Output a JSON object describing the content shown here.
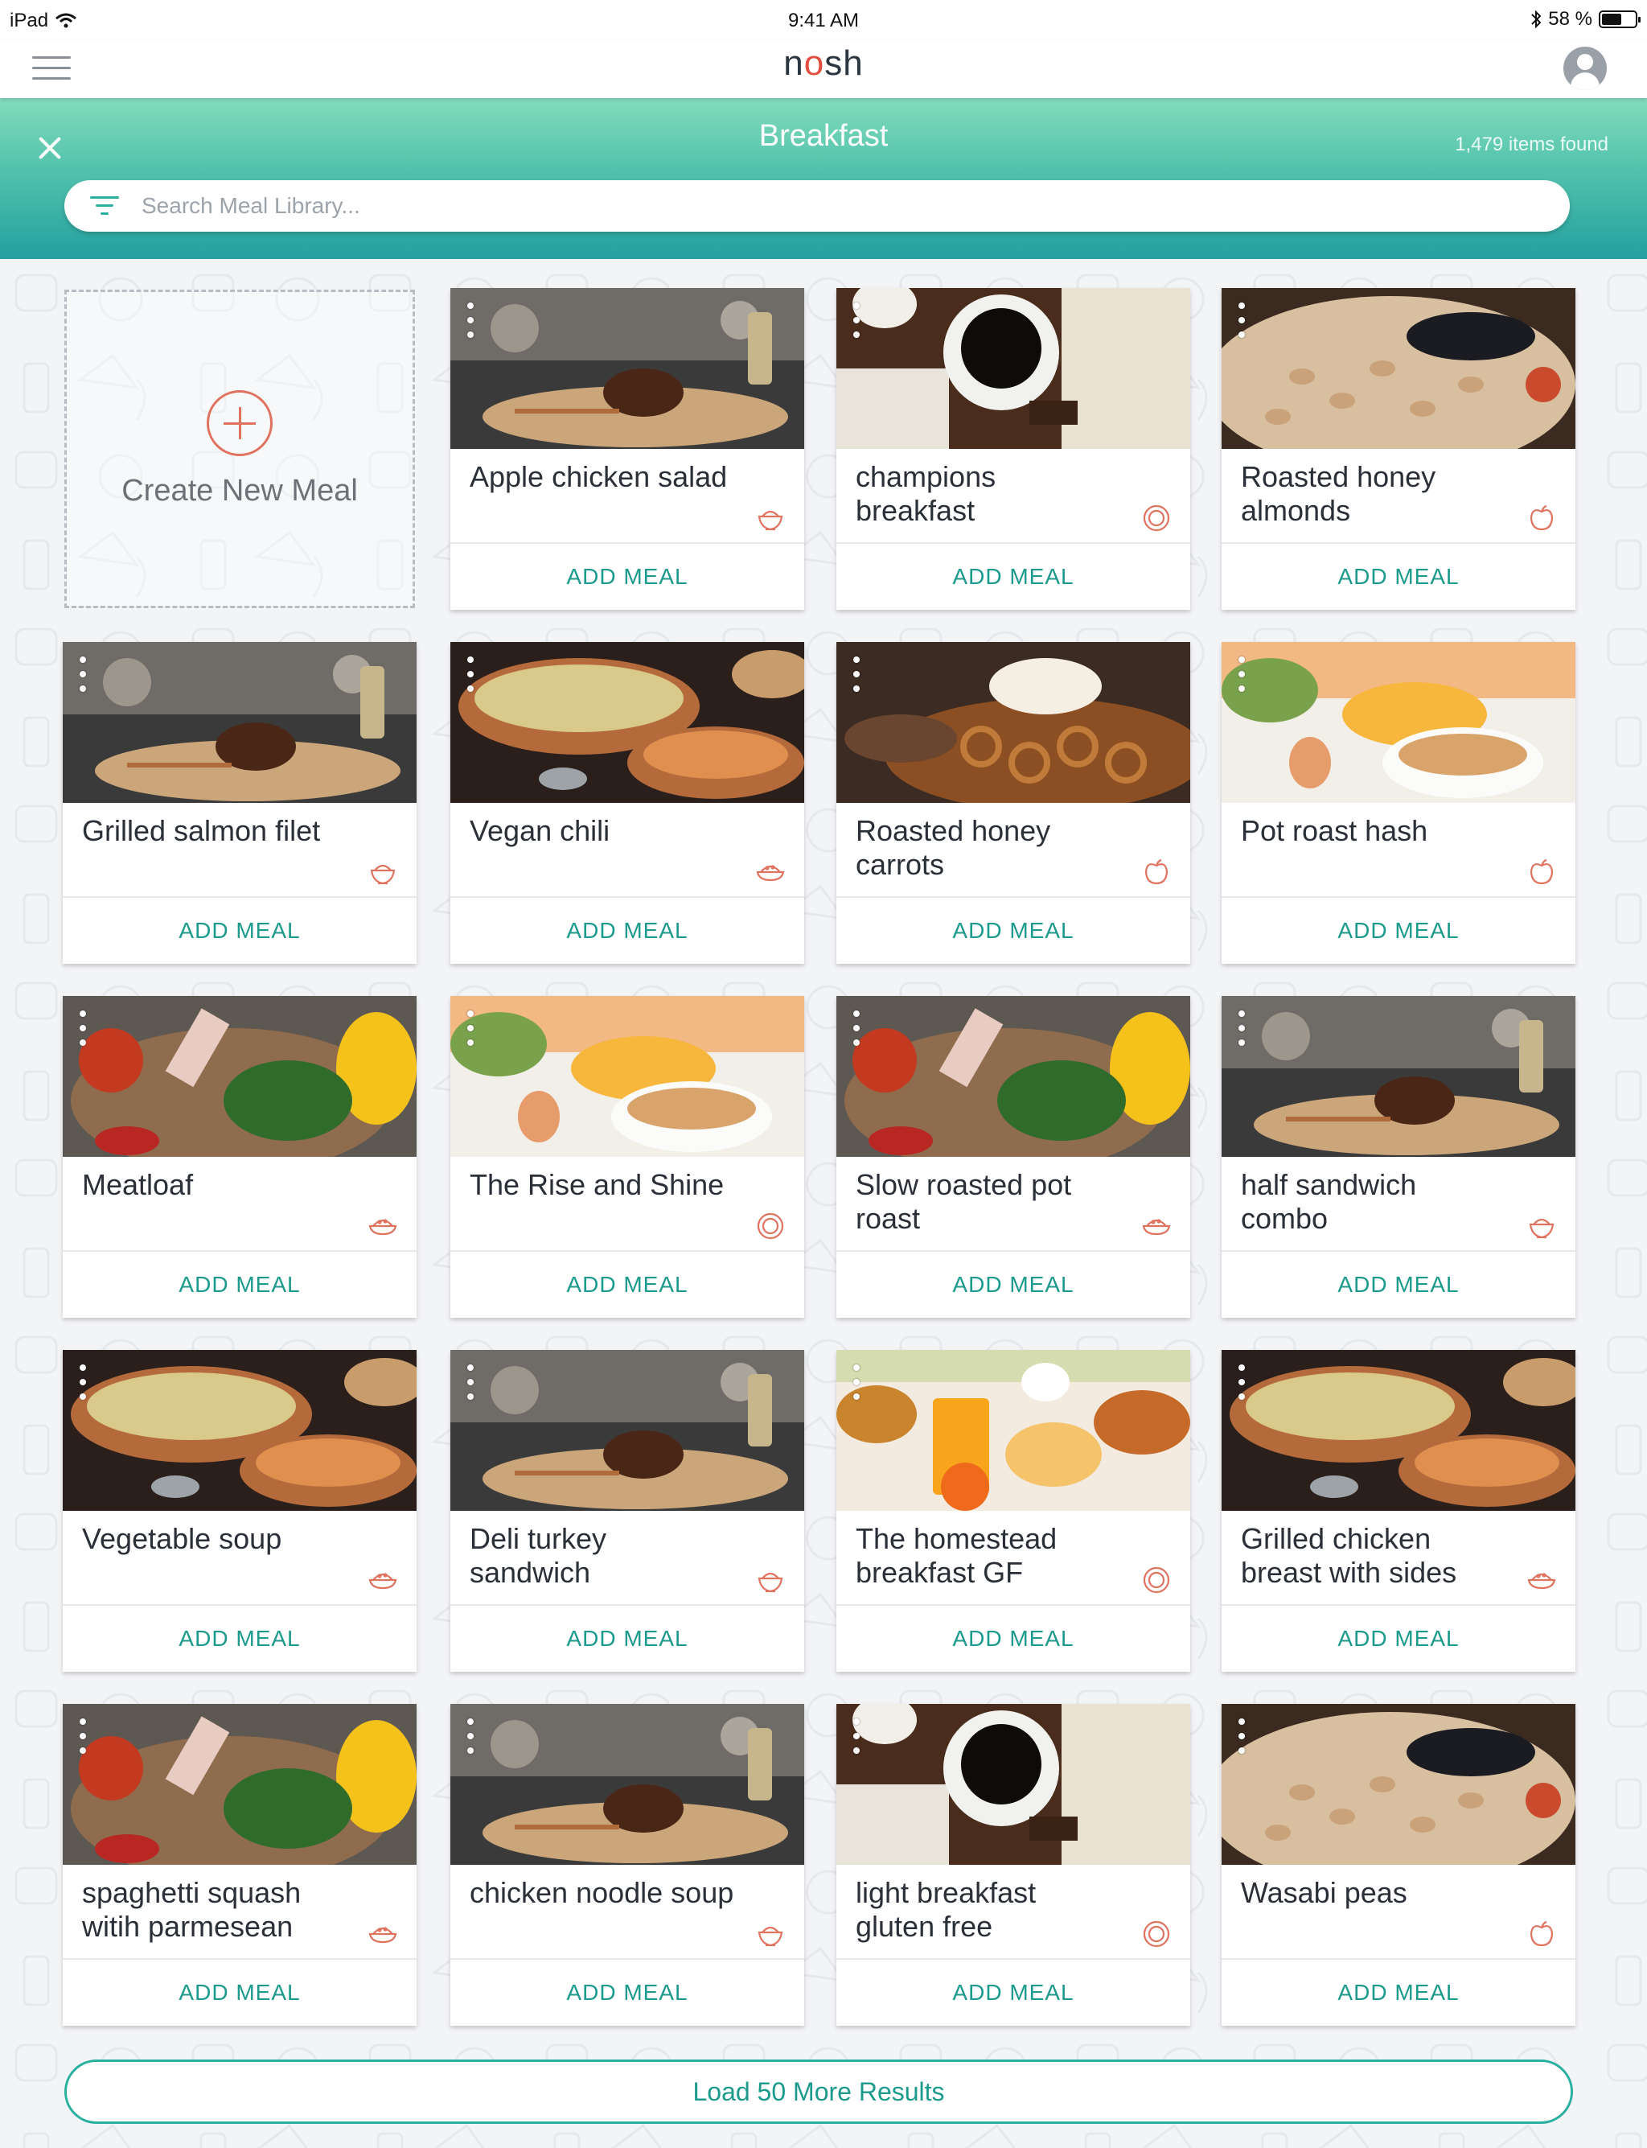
{
  "status_bar": {
    "carrier": "iPad",
    "time": "9:41 AM",
    "battery": "58 %",
    "battery_level": 0.58
  },
  "header": {
    "logo_prefix": "n",
    "logo_o": "o",
    "logo_suffix": "sh"
  },
  "banner": {
    "title": "Breakfast",
    "items_found": "1,479 items found",
    "search_placeholder": "Search Meal Library..."
  },
  "create_card": {
    "label": "Create New Meal"
  },
  "meals": [
    {
      "name": "Apple chicken salad",
      "icon": "bowl-icon",
      "photo": "steak"
    },
    {
      "name": "champions breakfast",
      "icon": "plate-icon",
      "photo": "coffee"
    },
    {
      "name": "Roasted honey almonds",
      "icon": "apple-icon",
      "photo": "nuts"
    },
    {
      "name": "Grilled salmon filet",
      "icon": "bowl-icon",
      "photo": "steak"
    },
    {
      "name": "Vegan chili",
      "icon": "dish-icon",
      "photo": "curry"
    },
    {
      "name": "Roasted honey carrots",
      "icon": "apple-icon",
      "photo": "pretzels"
    },
    {
      "name": "Pot roast hash",
      "icon": "apple-icon",
      "photo": "tea"
    },
    {
      "name": "Meatloaf",
      "icon": "dish-icon",
      "photo": "veggies"
    },
    {
      "name": "The Rise and Shine",
      "icon": "plate-icon",
      "photo": "tea"
    },
    {
      "name": "Slow roasted pot roast",
      "icon": "dish-icon",
      "photo": "veggies"
    },
    {
      "name": "half sandwich combo",
      "icon": "bowl-icon",
      "photo": "steak"
    },
    {
      "name": "Vegetable soup",
      "icon": "dish-icon",
      "photo": "curry"
    },
    {
      "name": "Deli turkey sandwich",
      "icon": "bowl-icon",
      "photo": "steak"
    },
    {
      "name": "The homestead breakfast GF",
      "icon": "plate-icon",
      "photo": "juice"
    },
    {
      "name": "Grilled chicken breast with sides",
      "icon": "dish-icon",
      "photo": "curry"
    },
    {
      "name": "spaghetti squash witih parmesean",
      "icon": "dish-icon",
      "photo": "veggies"
    },
    {
      "name": "chicken noodle soup",
      "icon": "bowl-icon",
      "photo": "steak"
    },
    {
      "name": "light breakfast gluten free",
      "icon": "plate-icon",
      "photo": "coffee"
    },
    {
      "name": "Wasabi peas",
      "icon": "apple-icon",
      "photo": "nuts"
    }
  ],
  "add_meal_label": "ADD MEAL",
  "load_more_label": "Load 50 More Results",
  "colors": {
    "accent": "#1c9a8c",
    "coral": "#e0735f",
    "teal_top": "#82dcbb",
    "teal_bottom": "#23a0a0"
  }
}
